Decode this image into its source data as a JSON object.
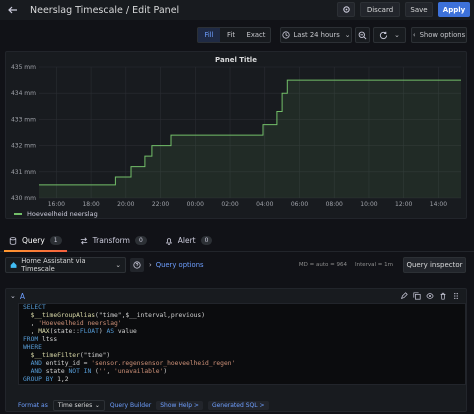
{
  "header": {
    "title": "Neerslag Timescale / Edit Panel",
    "discard_label": "Discard",
    "save_label": "Save",
    "apply_label": "Apply"
  },
  "toolbar": {
    "fill_label": "Fill",
    "fit_label": "Fit",
    "exact_label": "Exact",
    "time_range": "Last 24 hours",
    "show_options_label": "Show options"
  },
  "panel": {
    "title": "Panel Title",
    "legend_label": "Hoeveelheid neerslag"
  },
  "chart_data": {
    "type": "line",
    "ylabel": "",
    "xlabel": "",
    "yticks": [
      "430 mm",
      "431 mm",
      "432 mm",
      "433 mm",
      "434 mm",
      "435 mm"
    ],
    "xticks": [
      "16:00",
      "18:00",
      "20:00",
      "22:00",
      "00:00",
      "02:00",
      "04:00",
      "06:00",
      "08:00",
      "10:00",
      "12:00",
      "14:00"
    ],
    "ylim": [
      430,
      435
    ],
    "xlim_hours": [
      15.0,
      39.3
    ],
    "grid": true,
    "series": [
      {
        "name": "Hoeveelheid neerslag",
        "color": "#73bf69",
        "x_hours": [
          15.0,
          19.4,
          19.4,
          20.3,
          20.3,
          21.1,
          21.1,
          21.5,
          21.5,
          22.6,
          22.6,
          27.9,
          27.9,
          28.7,
          28.7,
          29.0,
          29.0,
          29.3,
          29.3,
          39.3
        ],
        "values": [
          430.5,
          430.5,
          430.8,
          430.8,
          431.2,
          431.2,
          431.6,
          431.6,
          432.0,
          432.0,
          432.4,
          432.4,
          432.8,
          432.8,
          433.3,
          433.3,
          434.0,
          434.0,
          434.5,
          434.5
        ]
      }
    ]
  },
  "query_tabs": {
    "query_label": "Query",
    "query_count": "1",
    "transform_label": "Transform",
    "transform_count": "0",
    "alert_label": "Alert",
    "alert_count": "0"
  },
  "datasource": {
    "name": "Home Assistant via Timescale",
    "query_options_label": "Query options",
    "meta_md": "MD = auto = 964",
    "meta_interval": "Interval = 1m",
    "query_inspector_label": "Query inspector"
  },
  "query": {
    "name": "A",
    "format_label": "Format as",
    "format_value": "Time series",
    "query_builder_label": "Query Builder",
    "show_help_label": "Show Help >",
    "generated_sql_label": "Generated SQL >"
  }
}
